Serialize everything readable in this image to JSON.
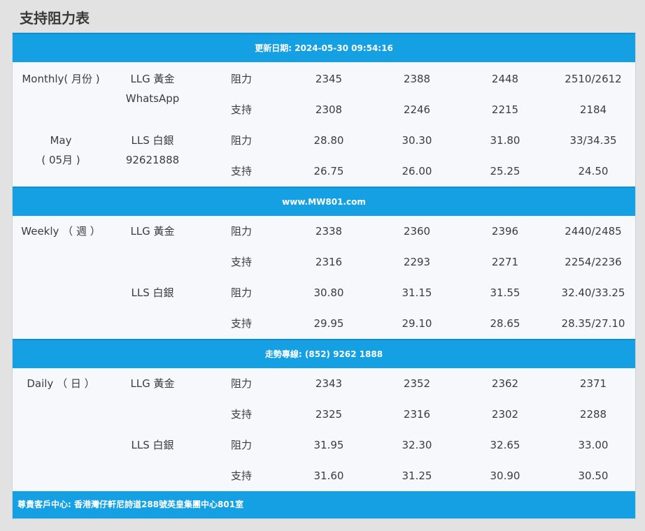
{
  "page": {
    "title": "支持阻力表"
  },
  "bands": {
    "updated": "更新日期: 2024-05-30 09:54:16",
    "website": "www.MW801.com",
    "hotline": "走勢專線: (852) 9262 1888",
    "footer": "尊貴客戶中心: 香港灣仔軒尼詩道288號英皇集團中心801室"
  },
  "labels": {
    "resistance": "阻力",
    "support": "支持"
  },
  "monthly": {
    "period": "Monthly( 月份 )",
    "period_sub1": "May",
    "period_sub2": "( 05月 )",
    "gold_label": "LLG 黃金",
    "gold_sub": "WhatsApp",
    "silver_label": "LLS 白銀",
    "silver_sub": "92621888",
    "gold_resistance": [
      "2345",
      "2388",
      "2448",
      "2510/2612"
    ],
    "gold_support": [
      "2308",
      "2246",
      "2215",
      "2184"
    ],
    "silver_resistance": [
      "28.80",
      "30.30",
      "31.80",
      "33/34.35"
    ],
    "silver_support": [
      "26.75",
      "26.00",
      "25.25",
      "24.50"
    ]
  },
  "weekly": {
    "period": "Weekly （ 週 ）",
    "gold_label": "LLG 黃金",
    "silver_label": "LLS 白銀",
    "gold_resistance": [
      "2338",
      "2360",
      "2396",
      "2440/2485"
    ],
    "gold_support": [
      "2316",
      "2293",
      "2271",
      "2254/2236"
    ],
    "silver_resistance": [
      "30.80",
      "31.15",
      "31.55",
      "32.40/33.25"
    ],
    "silver_support": [
      "29.95",
      "29.10",
      "28.65",
      "28.35/27.10"
    ]
  },
  "daily": {
    "period": "Daily （ 日 ）",
    "gold_label": "LLG 黃金",
    "silver_label": "LLS 白銀",
    "gold_resistance": [
      "2343",
      "2352",
      "2362",
      "2371"
    ],
    "gold_support": [
      "2325",
      "2316",
      "2302",
      "2288"
    ],
    "silver_resistance": [
      "31.95",
      "32.30",
      "32.65",
      "33.00"
    ],
    "silver_support": [
      "31.60",
      "31.25",
      "30.90",
      "30.50"
    ]
  }
}
